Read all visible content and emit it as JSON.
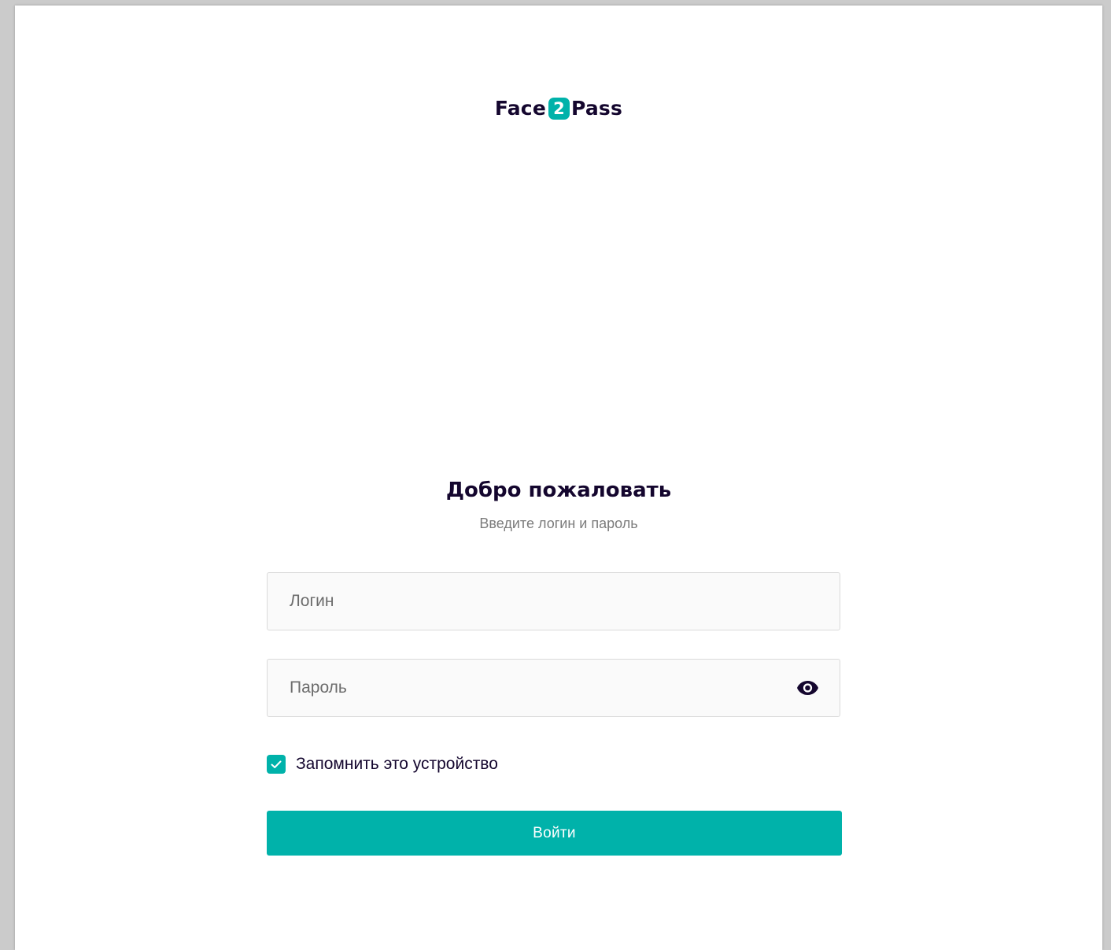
{
  "colors": {
    "accent": "#00b2aa",
    "text_dark": "#14062e",
    "text_muted": "#7b7b7b"
  },
  "logo": {
    "part1": "Face",
    "badge": "2",
    "part2": "Pass"
  },
  "heading": "Добро пожаловать",
  "subheading": "Введите логин и пароль",
  "login_field": {
    "placeholder": "Логин",
    "value": ""
  },
  "password_field": {
    "placeholder": "Пароль",
    "value": "",
    "toggle_icon": "eye-icon"
  },
  "remember": {
    "label": "Запомнить это устройство",
    "checked": true,
    "icon": "checkmark-icon"
  },
  "submit_label": "Войти"
}
